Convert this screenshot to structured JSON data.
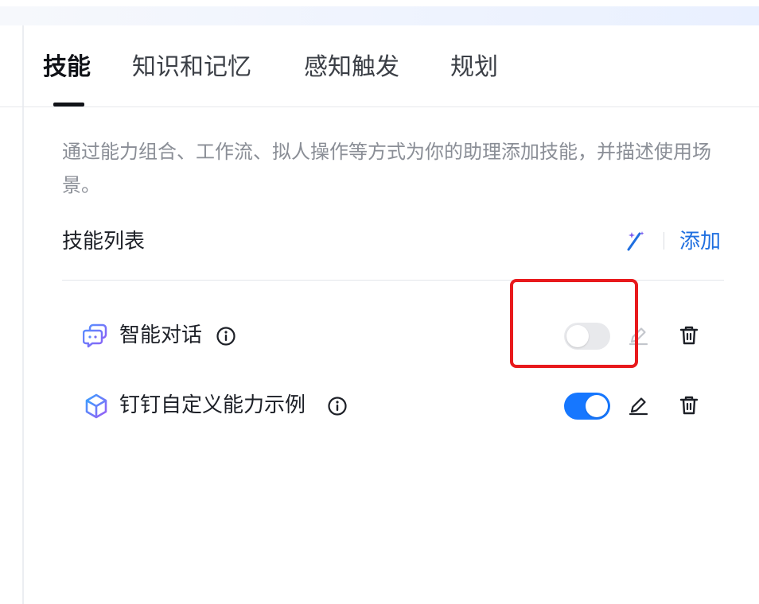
{
  "tabs": [
    {
      "label": "技能",
      "active": true
    },
    {
      "label": "知识和记忆",
      "active": false
    },
    {
      "label": "感知触发",
      "active": false
    },
    {
      "label": "规划",
      "active": false
    }
  ],
  "description": "通过能力组合、工作流、拟人操作等方式为你的助理添加技能，并描述使用场景。",
  "skill_list": {
    "title": "技能列表",
    "add_label": "添加",
    "items": [
      {
        "label": "智能对话",
        "icon": "chat-bubbles-icon",
        "enabled": false,
        "edit_disabled": true
      },
      {
        "label": "钉钉自定义能力示例",
        "icon": "cube-icon",
        "enabled": true,
        "edit_disabled": false
      }
    ]
  },
  "colors": {
    "accent": "#1677ff",
    "link": "#1f6fe0",
    "highlight": "#e8191c",
    "toggle_off": "#e8e9ec"
  }
}
